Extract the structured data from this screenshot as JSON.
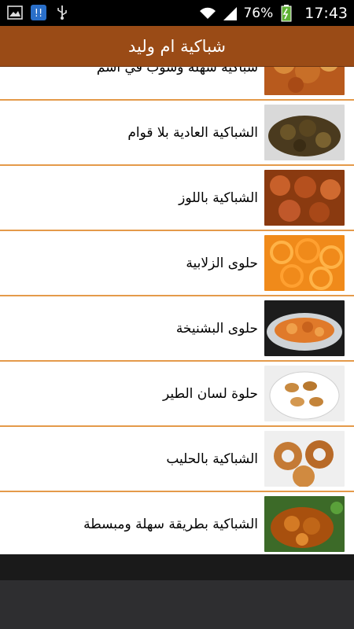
{
  "statusbar": {
    "battery": "76%",
    "time": "17:43",
    "icons": [
      "image-icon",
      "notification-app-icon",
      "usb-icon",
      "wifi-icon",
      "signal-icon",
      "battery-icon"
    ]
  },
  "app": {
    "title": "شباكية ام وليد",
    "header_color": "#9a4b16",
    "divider_color": "#e49a4a"
  },
  "items": [
    {
      "label": "شباكية سهلة وشوب في أشم",
      "thumb": "partial-chebakia-icon",
      "partial": true
    },
    {
      "label": "الشباكية العادية بلا قوام",
      "thumb": "dark-chebakia-icon"
    },
    {
      "label": "الشباكية باللوز",
      "thumb": "almond-chebakia-icon"
    },
    {
      "label": "حلوى الزلابية",
      "thumb": "zlabia-icon"
    },
    {
      "label": "حلوى البشنيخة",
      "thumb": "bechnikha-icon"
    },
    {
      "label": "حلوة لسان الطير",
      "thumb": "lsan-tir-icon"
    },
    {
      "label": "الشباكية بالحليب",
      "thumb": "milk-chebakia-icon"
    },
    {
      "label": "الشباكية بطريقة سهلة ومبسطة",
      "thumb": "easy-chebakia-icon"
    }
  ]
}
